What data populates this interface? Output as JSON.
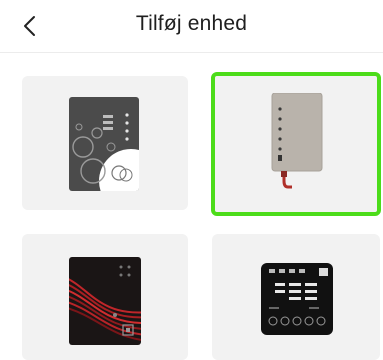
{
  "header": {
    "title": "Tilføj enhed",
    "back_icon": "chevron-left-icon"
  },
  "devices": [
    {
      "image": "gray-white-circles-panel",
      "selected": false
    },
    {
      "image": "beige-indicator-unit",
      "selected": true
    },
    {
      "image": "red-wave-panel",
      "selected": false
    },
    {
      "image": "black-display-controller",
      "selected": false
    }
  ],
  "colors": {
    "selection": "#4cdc1a",
    "card_bg": "#f2f2f2"
  }
}
